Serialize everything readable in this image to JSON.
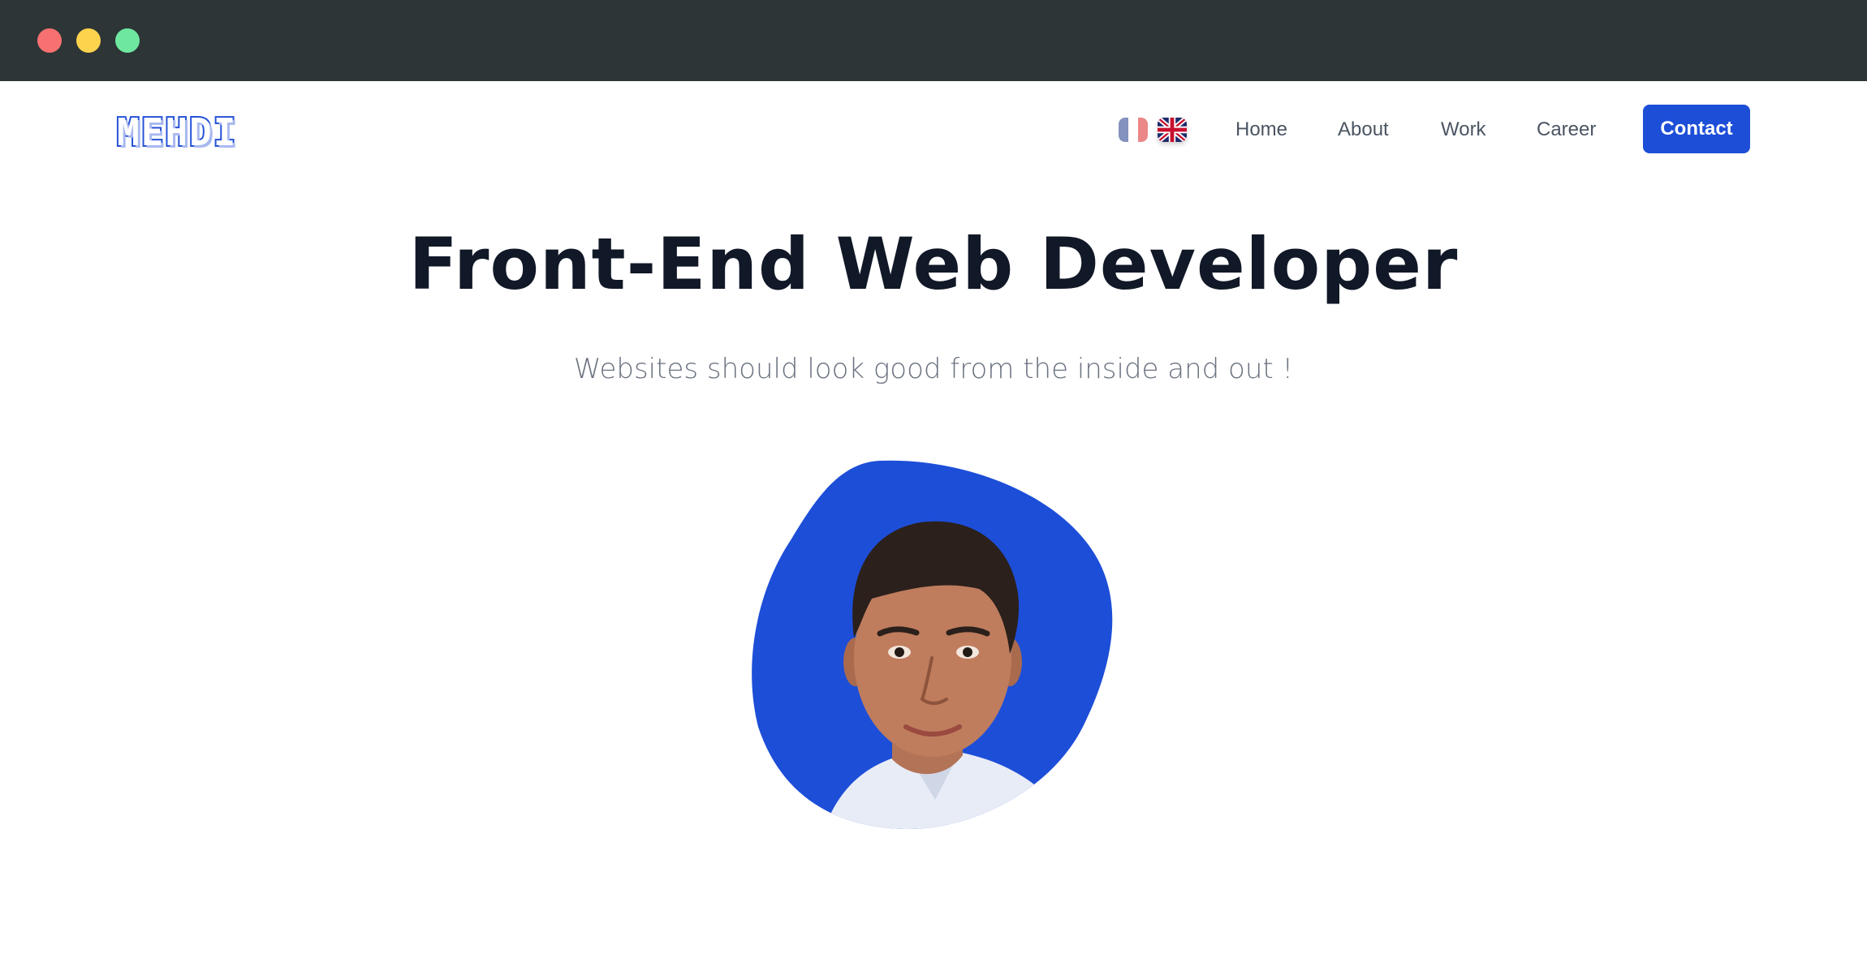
{
  "window": {
    "controls": [
      "close",
      "minimize",
      "maximize"
    ]
  },
  "header": {
    "logo_text": "MEHDI",
    "languages": [
      {
        "code": "fr",
        "icon": "france-flag-icon"
      },
      {
        "code": "en",
        "icon": "uk-flag-icon"
      }
    ],
    "nav": [
      "Home",
      "About",
      "Work",
      "Career"
    ],
    "contact_label": "Contact"
  },
  "hero": {
    "title": "Front-End Web Developer",
    "subtitle": "Websites should look good from the inside and out !"
  },
  "colors": {
    "accent": "#1d4ed8",
    "titlebar": "#2d3536",
    "heading": "#111827",
    "muted": "#6b7280"
  }
}
